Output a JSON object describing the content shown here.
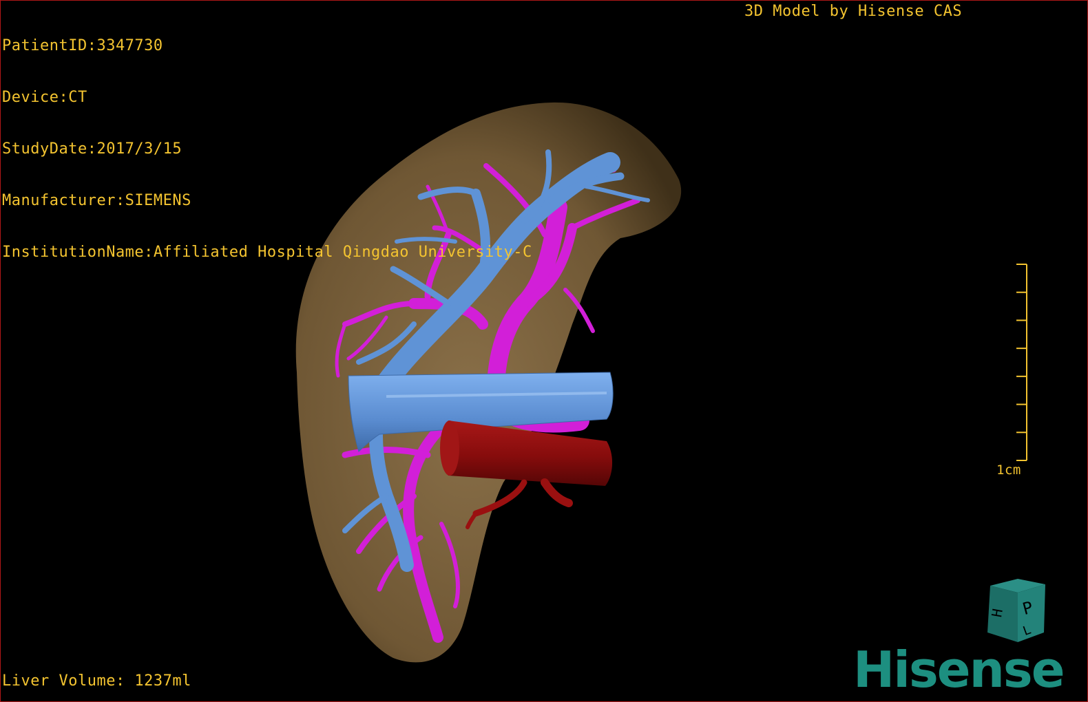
{
  "header": {
    "patient_id": "PatientID:3347730",
    "device": "Device:CT",
    "study_date": "StudyDate:2017/3/15",
    "manufacturer": "Manufacturer:SIEMENS",
    "institution": "InstitutionName:Affiliated Hospital Qingdao University-C"
  },
  "credit": "3D Model by Hisense CAS",
  "footer": {
    "liver_volume": "Liver Volume: 1237ml"
  },
  "scale_bar": {
    "label": "1cm",
    "tick_count": 8
  },
  "orientation_cube": {
    "face_labels": [
      "P",
      "H",
      "L"
    ]
  },
  "logo": {
    "text": "Hisense"
  },
  "colors": {
    "overlay_text": "#f4c430",
    "liver": "#7d6440",
    "hepatic_vein": "#5f93d6",
    "portal_vein": "#d21fd8",
    "aorta": "#8d0e0e",
    "logo": "#1d8f80",
    "border": "#b01818"
  },
  "icons": [
    "orientation-cube-icon"
  ]
}
